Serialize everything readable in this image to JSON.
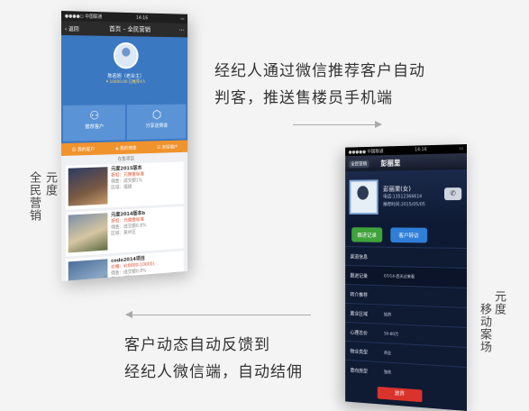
{
  "captions": {
    "top_line1": "经纪人通过微信推荐客户自动",
    "top_line2": "判客，推送售楼员手机端",
    "bottom_line1": "客户动态自动反馈到",
    "bottom_line2": "经纪人微信端，自动结佣"
  },
  "side_labels": {
    "left_line1": "元度",
    "left_line2": "全民营销",
    "right_line1": "元度",
    "right_line2": "移动案场"
  },
  "left_phone": {
    "status_carrier": "●●●●○ 中国联通",
    "status_time": "14:16",
    "status_battery": "▭",
    "back_label": "返回",
    "title": "首页 – 全民营销",
    "more": "···",
    "user_name": "陈若旭（老业主）",
    "amount": "¥ 10000.00  已推荐4人",
    "tile1_label": "推荐客户",
    "tile2_label": "分享送佣金",
    "tab1": "我的客户",
    "tab2": "我的佣金",
    "tab3": "未结佣户",
    "section": "在售项目",
    "items": [
      {
        "title": "元度2015版本",
        "line1": "折扣：元佣金标准",
        "line2": "佣金：成交额1%",
        "line3": "区域：福建"
      },
      {
        "title": "元度2014版本b",
        "line1": "折扣：元佣金标准",
        "line2": "佣金：成交额0.8%",
        "line3": "区域：吴中区"
      },
      {
        "title": "code2014项目",
        "line1": "价格：¥(8000-10000)",
        "line2": "佣金：成交额0.8%",
        "line3": "区域：福建"
      }
    ]
  },
  "right_phone": {
    "status_carrier": "●●●●● 中国联通",
    "status_time": "14:16",
    "status_battery": "▭",
    "back_label": "全民营销",
    "title": "彭丽里",
    "name_line": "彭丽里(女)",
    "phone_line": "电话:13512366614",
    "date_line": "推荐时间:2015/05/05",
    "btn_follow": "跟进记录",
    "btn_transfer": "客户转访",
    "rows": [
      {
        "k": "渠道信息",
        "v": ""
      },
      {
        "k": "跟进记录",
        "v": "07/14-后天过来看"
      },
      {
        "k": "转介推荐",
        "v": ""
      },
      {
        "k": "置业区域",
        "v": "姑苏"
      },
      {
        "k": "心理总价",
        "v": "50-80万"
      },
      {
        "k": "物业类型",
        "v": "商业"
      },
      {
        "k": "意向房型",
        "v": "独栋"
      }
    ],
    "btn_abandon": "放弃"
  },
  "colors": {
    "accent_blue": "#3a78c2",
    "accent_orange": "#f0932c",
    "dark_navy": "#0f1a33"
  }
}
